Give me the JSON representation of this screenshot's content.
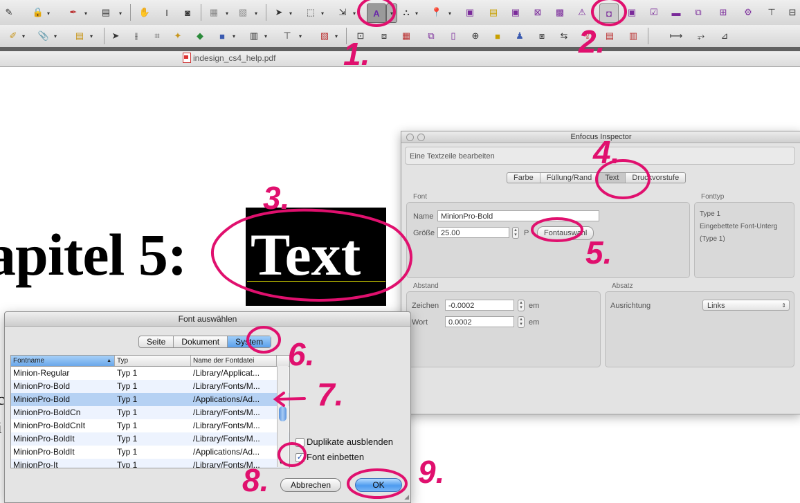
{
  "document_tab": {
    "filename": "indesign_cs4_help.pdf"
  },
  "headline": {
    "before": "apitel 5:",
    "selected": "Text"
  },
  "body_fragments": [
    "c",
    "i"
  ],
  "inspector": {
    "title": "Enfocus Inspector",
    "subtitle": "Eine Textzeile bearbeiten",
    "tabs": [
      "Farbe",
      "Füllung/Rand",
      "Text",
      "Druckvorstufe"
    ],
    "font_group": {
      "label": "Font",
      "name_label": "Name",
      "name_value": "MinionPro-Bold",
      "size_label": "Größe",
      "size_value": "25.00",
      "unit": "P",
      "font_button": "Fontauswahl"
    },
    "fonttype_group": {
      "label": "Fonttyp",
      "lines": [
        "Type 1",
        "Eingebettete Font-Unterg",
        "(Type 1)"
      ]
    },
    "spacing_group": {
      "label": "Abstand",
      "char_label": "Zeichen",
      "char_value": "-0.0002",
      "word_label": "Wort",
      "word_value": "0.0002",
      "unit": "em"
    },
    "paragraph_group": {
      "label": "Absatz",
      "align_label": "Ausrichtung",
      "align_value": "Links"
    }
  },
  "font_dialog": {
    "title": "Font auswählen",
    "tabs": [
      "Seite",
      "Dokument",
      "System"
    ],
    "columns": [
      "Fontname",
      "Typ",
      "Name der Fontdatei"
    ],
    "rows": [
      [
        "Minion-Regular",
        "Typ 1",
        "/Library/Applicat..."
      ],
      [
        "MinionPro-Bold",
        "Typ 1",
        "/Library/Fonts/M..."
      ],
      [
        "MinionPro-Bold",
        "Typ 1",
        "/Applications/Ad..."
      ],
      [
        "MinionPro-BoldCn",
        "Typ 1",
        "/Library/Fonts/M..."
      ],
      [
        "MinionPro-BoldCnIt",
        "Typ 1",
        "/Library/Fonts/M..."
      ],
      [
        "MinionPro-BoldIt",
        "Typ 1",
        "/Library/Fonts/M..."
      ],
      [
        "MinionPro-BoldIt",
        "Typ 1",
        "/Applications/Ad..."
      ],
      [
        "MinionPro-It",
        "Typ 1",
        "/Library/Fonts/M..."
      ]
    ],
    "selected_row": 2,
    "hide_duplicates_label": "Duplikate ausblenden",
    "hide_duplicates_checked": false,
    "embed_font_label": "Font einbetten",
    "embed_font_checked": true,
    "cancel_label": "Abbrechen",
    "ok_label": "OK"
  },
  "annotations": [
    "1.",
    "2.",
    "3.",
    "4.",
    "5.",
    "6.",
    "7.",
    "8.",
    "9."
  ],
  "colors": {
    "annotation": "#e0106e",
    "selection": "#b5d1f3",
    "accent": "#4d9bef"
  }
}
